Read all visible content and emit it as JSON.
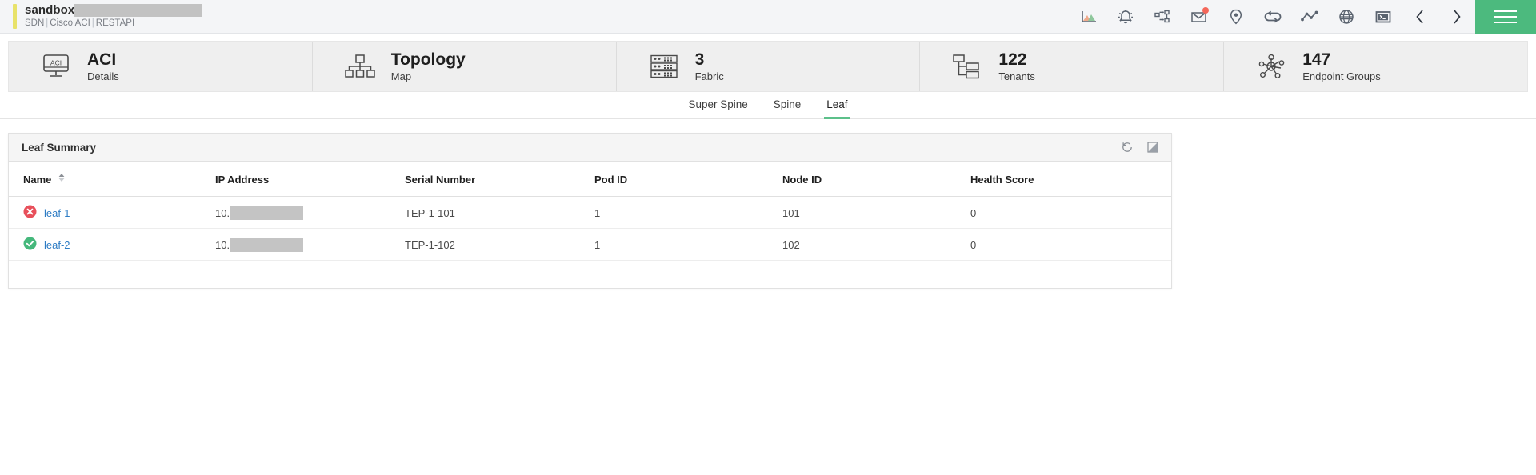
{
  "header": {
    "brand_title": "sandbox",
    "brand_title_redacted": true,
    "brand_sub_1": "SDN",
    "brand_sub_2": "Cisco ACI",
    "brand_sub_3": "RESTAPI",
    "separator": "|",
    "accent_green": "#4cba7e",
    "accent_yellow": "#e8e26a",
    "badge_color": "#f4675a",
    "icons": [
      {
        "name": "analytics-chart-icon",
        "title": "Analytics"
      },
      {
        "name": "alarm-bell-icon",
        "title": "Alarms"
      },
      {
        "name": "workflow-icon",
        "title": "Workflow"
      },
      {
        "name": "mail-envelope-icon",
        "title": "Mail",
        "badge": true
      },
      {
        "name": "location-pin-icon",
        "title": "Location"
      },
      {
        "name": "link-chain-icon",
        "title": "Links"
      },
      {
        "name": "trend-line-icon",
        "title": "Trends"
      },
      {
        "name": "globe-icon",
        "title": "Global"
      },
      {
        "name": "terminal-console-icon",
        "title": "Console"
      },
      {
        "name": "chevron-left-icon",
        "title": "Previous"
      },
      {
        "name": "chevron-right-icon",
        "title": "Next"
      }
    ],
    "menu_label": "Menu"
  },
  "kpis": [
    {
      "icon": "monitor-aci-icon",
      "value": "ACI",
      "label": "Details"
    },
    {
      "icon": "topology-tree-icon",
      "value": "Topology",
      "label": "Map"
    },
    {
      "icon": "fabric-rack-icon",
      "value": "3",
      "label": "Fabric"
    },
    {
      "icon": "tenants-hierarchy-icon",
      "value": "122",
      "label": "Tenants"
    },
    {
      "icon": "endpoint-groups-node-icon",
      "value": "147",
      "label": "Endpoint Groups"
    }
  ],
  "tabs": [
    {
      "label": "Super Spine",
      "active": false
    },
    {
      "label": "Spine",
      "active": false
    },
    {
      "label": "Leaf",
      "active": true
    }
  ],
  "panel": {
    "title": "Leaf Summary",
    "actions": [
      {
        "name": "refresh-history-icon",
        "title": "Refresh"
      },
      {
        "name": "expand-popout-icon",
        "title": "Expand"
      }
    ]
  },
  "table": {
    "columns": [
      {
        "key": "name",
        "label": "Name",
        "sortable": true,
        "sorted": "asc"
      },
      {
        "key": "ip",
        "label": "IP Address",
        "sortable": false
      },
      {
        "key": "serial",
        "label": "Serial Number",
        "sortable": false
      },
      {
        "key": "pod",
        "label": "Pod ID",
        "sortable": false
      },
      {
        "key": "node",
        "label": "Node ID",
        "sortable": false
      },
      {
        "key": "health",
        "label": "Health Score",
        "sortable": false
      }
    ],
    "rows": [
      {
        "status": "error",
        "status_icon": "error-circle-icon",
        "name": "leaf-1",
        "ip_prefix": "10.",
        "ip_redacted": true,
        "serial": "TEP-1-101",
        "pod": "1",
        "node": "101",
        "health": "0"
      },
      {
        "status": "ok",
        "status_icon": "success-check-circle-icon",
        "name": "leaf-2",
        "ip_prefix": "10.",
        "ip_redacted": true,
        "serial": "TEP-1-102",
        "pod": "1",
        "node": "102",
        "health": "0"
      }
    ],
    "status_colors": {
      "error": "#e8505b",
      "ok": "#45b87c"
    }
  }
}
